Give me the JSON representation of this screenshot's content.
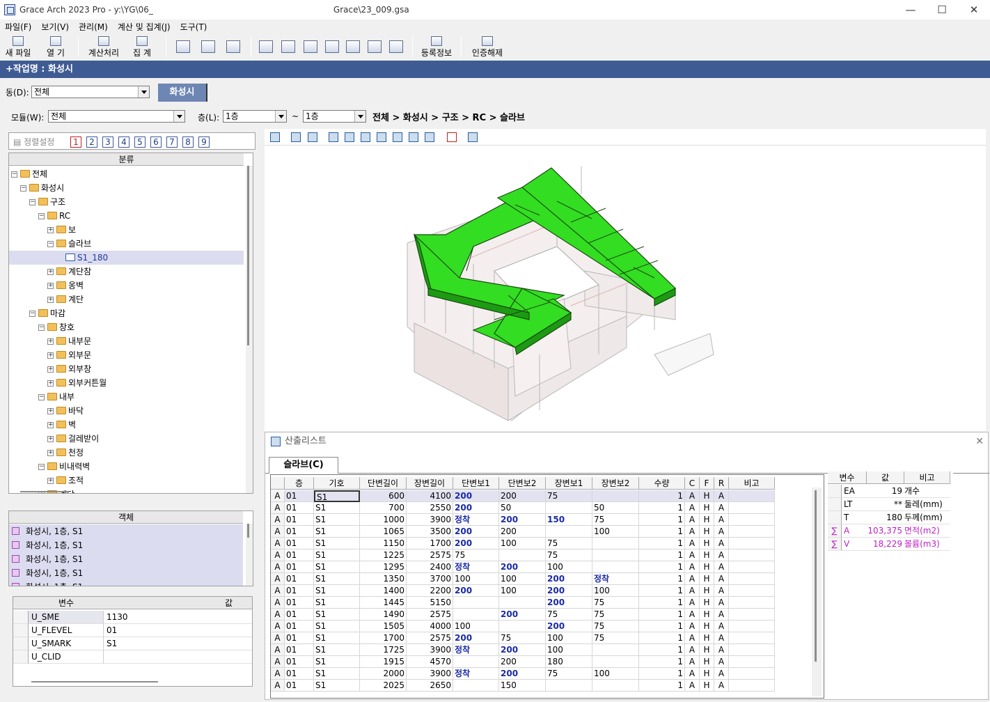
{
  "window": {
    "title": "Grace Arch 2023 Pro - y:\\YG\\06_",
    "title_tail": "Grace\\23_009.gsa",
    "minimize": "—",
    "maximize": "☐",
    "close": "✕"
  },
  "menu": [
    "파일(F)",
    "보기(V)",
    "관리(M)",
    "계산 및 집계(J)",
    "도구(T)"
  ],
  "toolbar": {
    "new": "새 파일",
    "open": "열  기",
    "calc": "계산처리",
    "sum": "집  계",
    "reg": "등록정보",
    "cert": "인증해제"
  },
  "job": {
    "title": "+작업명 : 화성시"
  },
  "dong": {
    "label": "동(D):",
    "value": "전체",
    "tab": "화성시"
  },
  "filters": {
    "module_label": "모듈(W):",
    "module_value": "전체",
    "floor_label": "층(L):",
    "floor_from": "1층",
    "tilde": "~",
    "floor_to": "1층"
  },
  "breadcrumb": "전체 > 화성시 > 구조 > RC > 슬라브",
  "left": {
    "sort_label": "정렬설정",
    "nums": [
      "1",
      "2",
      "3",
      "4",
      "5",
      "6",
      "7",
      "8",
      "9"
    ],
    "tree_header": "분류"
  },
  "tree": [
    {
      "label": "전체",
      "depth": 0,
      "exp": "−"
    },
    {
      "label": "화성시",
      "depth": 1,
      "exp": "−"
    },
    {
      "label": "구조",
      "depth": 2,
      "exp": "−"
    },
    {
      "label": "RC",
      "depth": 3,
      "exp": "−"
    },
    {
      "label": "보",
      "depth": 4,
      "exp": "+"
    },
    {
      "label": "슬라브",
      "depth": 4,
      "exp": "−"
    },
    {
      "label": "S1_180",
      "depth": 5,
      "exp": "",
      "selected": true
    },
    {
      "label": "계단참",
      "depth": 4,
      "exp": "+"
    },
    {
      "label": "옹벽",
      "depth": 4,
      "exp": "+"
    },
    {
      "label": "계단",
      "depth": 4,
      "exp": "+"
    },
    {
      "label": "마감",
      "depth": 2,
      "exp": "−"
    },
    {
      "label": "창호",
      "depth": 3,
      "exp": "−"
    },
    {
      "label": "내부문",
      "depth": 4,
      "exp": "+"
    },
    {
      "label": "외부문",
      "depth": 4,
      "exp": "+"
    },
    {
      "label": "외부창",
      "depth": 4,
      "exp": "+"
    },
    {
      "label": "외부커튼월",
      "depth": 4,
      "exp": "+"
    },
    {
      "label": "내부",
      "depth": 3,
      "exp": "−"
    },
    {
      "label": "바닥",
      "depth": 4,
      "exp": "+"
    },
    {
      "label": "벽",
      "depth": 4,
      "exp": "+"
    },
    {
      "label": "걸레받이",
      "depth": 4,
      "exp": "+"
    },
    {
      "label": "천정",
      "depth": 4,
      "exp": "+"
    },
    {
      "label": "비내력벽",
      "depth": 3,
      "exp": "−"
    },
    {
      "label": "조적",
      "depth": 4,
      "exp": "+"
    },
    {
      "label": "계단",
      "depth": 3,
      "exp": "+"
    }
  ],
  "objects": {
    "header": "객체",
    "rows": [
      "화성시, 1층, S1",
      "화성시, 1층, S1",
      "화성시, 1층, S1",
      "화성시, 1층, S1",
      "화성시, 1층, S1"
    ]
  },
  "vars": {
    "h_name": "변수",
    "h_val": "값",
    "rows": [
      [
        "U_SME",
        "1130"
      ],
      [
        "U_FLEVEL",
        "01"
      ],
      [
        "U_SMARK",
        "S1"
      ],
      [
        "U_CLID",
        ""
      ]
    ]
  },
  "calc": {
    "title": "산출리스트",
    "close": "✕",
    "tab": "슬라브(C)",
    "headers": [
      "",
      "층",
      "기호",
      "단변길이",
      "장변길이",
      "단변보1",
      "단변보2",
      "장변보1",
      "장변보2",
      "수량",
      "C",
      "F",
      "R",
      "비고"
    ],
    "rows": [
      [
        "A",
        "01",
        "S1",
        "600",
        "4100",
        "200",
        "200",
        "75",
        "",
        "1",
        "A",
        "H",
        "A",
        ""
      ],
      [
        "A",
        "01",
        "S1",
        "700",
        "2550",
        "200",
        "50",
        "",
        "50",
        "1",
        "A",
        "H",
        "A",
        ""
      ],
      [
        "A",
        "01",
        "S1",
        "1000",
        "3900",
        "정착",
        "200",
        "150",
        "75",
        "1",
        "A",
        "H",
        "A",
        ""
      ],
      [
        "A",
        "01",
        "S1",
        "1065",
        "3500",
        "200",
        "200",
        "",
        "100",
        "1",
        "A",
        "H",
        "A",
        ""
      ],
      [
        "A",
        "01",
        "S1",
        "1150",
        "1700",
        "200",
        "100",
        "75",
        "",
        "1",
        "A",
        "H",
        "A",
        ""
      ],
      [
        "A",
        "01",
        "S1",
        "1225",
        "2575",
        "75",
        "",
        "75",
        "",
        "1",
        "A",
        "H",
        "A",
        ""
      ],
      [
        "A",
        "01",
        "S1",
        "1295",
        "2400",
        "정착",
        "200",
        "100",
        "",
        "1",
        "A",
        "H",
        "A",
        ""
      ],
      [
        "A",
        "01",
        "S1",
        "1350",
        "3700",
        "100",
        "100",
        "200",
        "정착",
        "1",
        "A",
        "H",
        "A",
        ""
      ],
      [
        "A",
        "01",
        "S1",
        "1400",
        "2200",
        "200",
        "100",
        "200",
        "100",
        "1",
        "A",
        "H",
        "A",
        ""
      ],
      [
        "A",
        "01",
        "S1",
        "1445",
        "5150",
        "",
        "",
        "200",
        "75",
        "1",
        "A",
        "H",
        "A",
        ""
      ],
      [
        "A",
        "01",
        "S1",
        "1490",
        "2575",
        "",
        "200",
        "75",
        "75",
        "1",
        "A",
        "H",
        "A",
        ""
      ],
      [
        "A",
        "01",
        "S1",
        "1505",
        "4000",
        "100",
        "",
        "200",
        "75",
        "1",
        "A",
        "H",
        "A",
        ""
      ],
      [
        "A",
        "01",
        "S1",
        "1700",
        "2575",
        "200",
        "75",
        "100",
        "75",
        "1",
        "A",
        "H",
        "A",
        ""
      ],
      [
        "A",
        "01",
        "S1",
        "1725",
        "3900",
        "정착",
        "200",
        "100",
        "",
        "1",
        "A",
        "H",
        "A",
        ""
      ],
      [
        "A",
        "01",
        "S1",
        "1915",
        "4570",
        "",
        "200",
        "180",
        "",
        "1",
        "A",
        "H",
        "A",
        ""
      ],
      [
        "A",
        "01",
        "S1",
        "2000",
        "3900",
        "정착",
        "200",
        "75",
        "100",
        "1",
        "A",
        "H",
        "A",
        ""
      ],
      [
        "A",
        "01",
        "S1",
        "2025",
        "2650",
        "",
        "150",
        "",
        "",
        "1",
        "A",
        "H",
        "A",
        ""
      ]
    ],
    "bold": [
      [
        0,
        5
      ],
      [
        1,
        5
      ],
      [
        2,
        5
      ],
      [
        2,
        6
      ],
      [
        2,
        7
      ],
      [
        3,
        5
      ],
      [
        4,
        5
      ],
      [
        6,
        5
      ],
      [
        6,
        6
      ],
      [
        7,
        7
      ],
      [
        7,
        8
      ],
      [
        8,
        5
      ],
      [
        8,
        7
      ],
      [
        9,
        7
      ],
      [
        10,
        6
      ],
      [
        11,
        7
      ],
      [
        12,
        5
      ],
      [
        13,
        5
      ],
      [
        13,
        6
      ],
      [
        15,
        5
      ],
      [
        15,
        6
      ]
    ]
  },
  "summary": {
    "headers": [
      "변수",
      "값",
      "비고"
    ],
    "rows": [
      [
        "",
        "EA",
        "19",
        "개수"
      ],
      [
        "",
        "LT",
        "**",
        "둘레(mm)"
      ],
      [
        "",
        "T",
        "180",
        "두께(mm)"
      ],
      [
        "∑",
        "A",
        "103,375",
        "면적(m2)"
      ],
      [
        "∑",
        "V",
        "18,229",
        "볼륨(m3)"
      ]
    ]
  },
  "colors": {
    "accent": "#3f5b93",
    "tab": "#6e86b4",
    "slab": "#33dd22",
    "highlight": "#c020c0"
  }
}
